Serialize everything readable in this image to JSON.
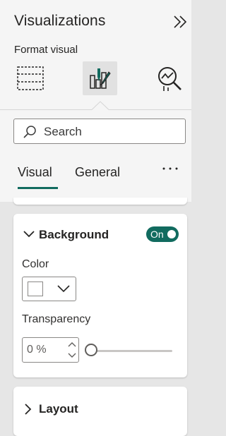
{
  "pane": {
    "title": "Visualizations",
    "subtitle": "Format visual",
    "icons": {
      "collapse": "double-chevron-right-icon",
      "build": "build-visual-icon",
      "format": "format-visual-icon",
      "analytics": "analytics-icon"
    }
  },
  "search": {
    "placeholder": "Search"
  },
  "tabs": [
    {
      "label": "Visual",
      "active": true
    },
    {
      "label": "General",
      "active": false
    }
  ],
  "more_icon": "more-options-icon",
  "background_card": {
    "title": "Background",
    "expanded": true,
    "toggle_label": "On",
    "toggle_on": true,
    "color_label": "Color",
    "color_value": "#ffffff",
    "transparency_label": "Transparency",
    "transparency_value": "0 %",
    "transparency_level": 0
  },
  "layout_card": {
    "title": "Layout",
    "expanded": false
  },
  "colors": {
    "accent": "#116b5f",
    "panel": "#f5f5f5",
    "background": "#e6e6e6"
  }
}
